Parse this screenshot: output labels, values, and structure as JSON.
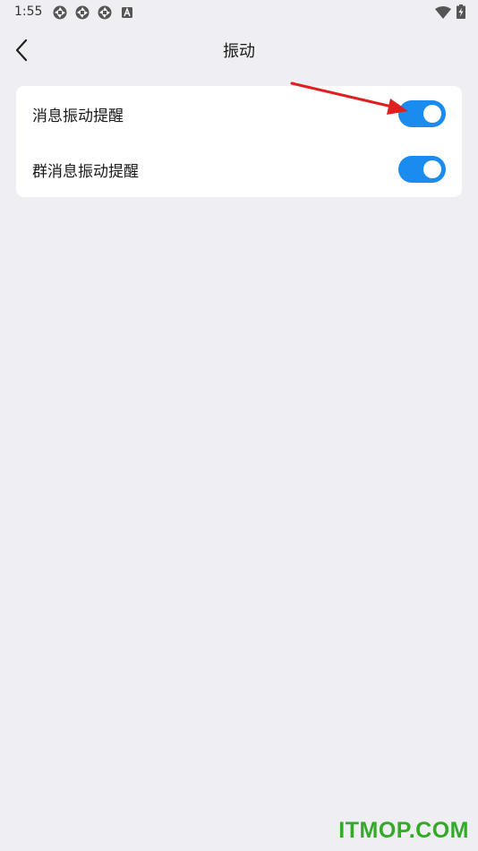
{
  "status_bar": {
    "time": "1:55",
    "left_icons": [
      "aperture-icon",
      "aperture-icon",
      "aperture-icon",
      "a-box-icon"
    ],
    "right_icons": [
      "wifi-icon",
      "battery-charging-icon"
    ]
  },
  "header": {
    "back_icon": "chevron-left-icon",
    "title": "振动"
  },
  "settings": {
    "rows": [
      {
        "label": "消息振动提醒",
        "enabled": true
      },
      {
        "label": "群消息振动提醒",
        "enabled": true
      }
    ]
  },
  "colors": {
    "background": "#efeff3",
    "card": "#ffffff",
    "toggle_on": "#1a8cf0",
    "annotation_arrow": "#e02020",
    "watermark": "#33aa28"
  },
  "watermark": {
    "text": "ITMOP.COM"
  }
}
